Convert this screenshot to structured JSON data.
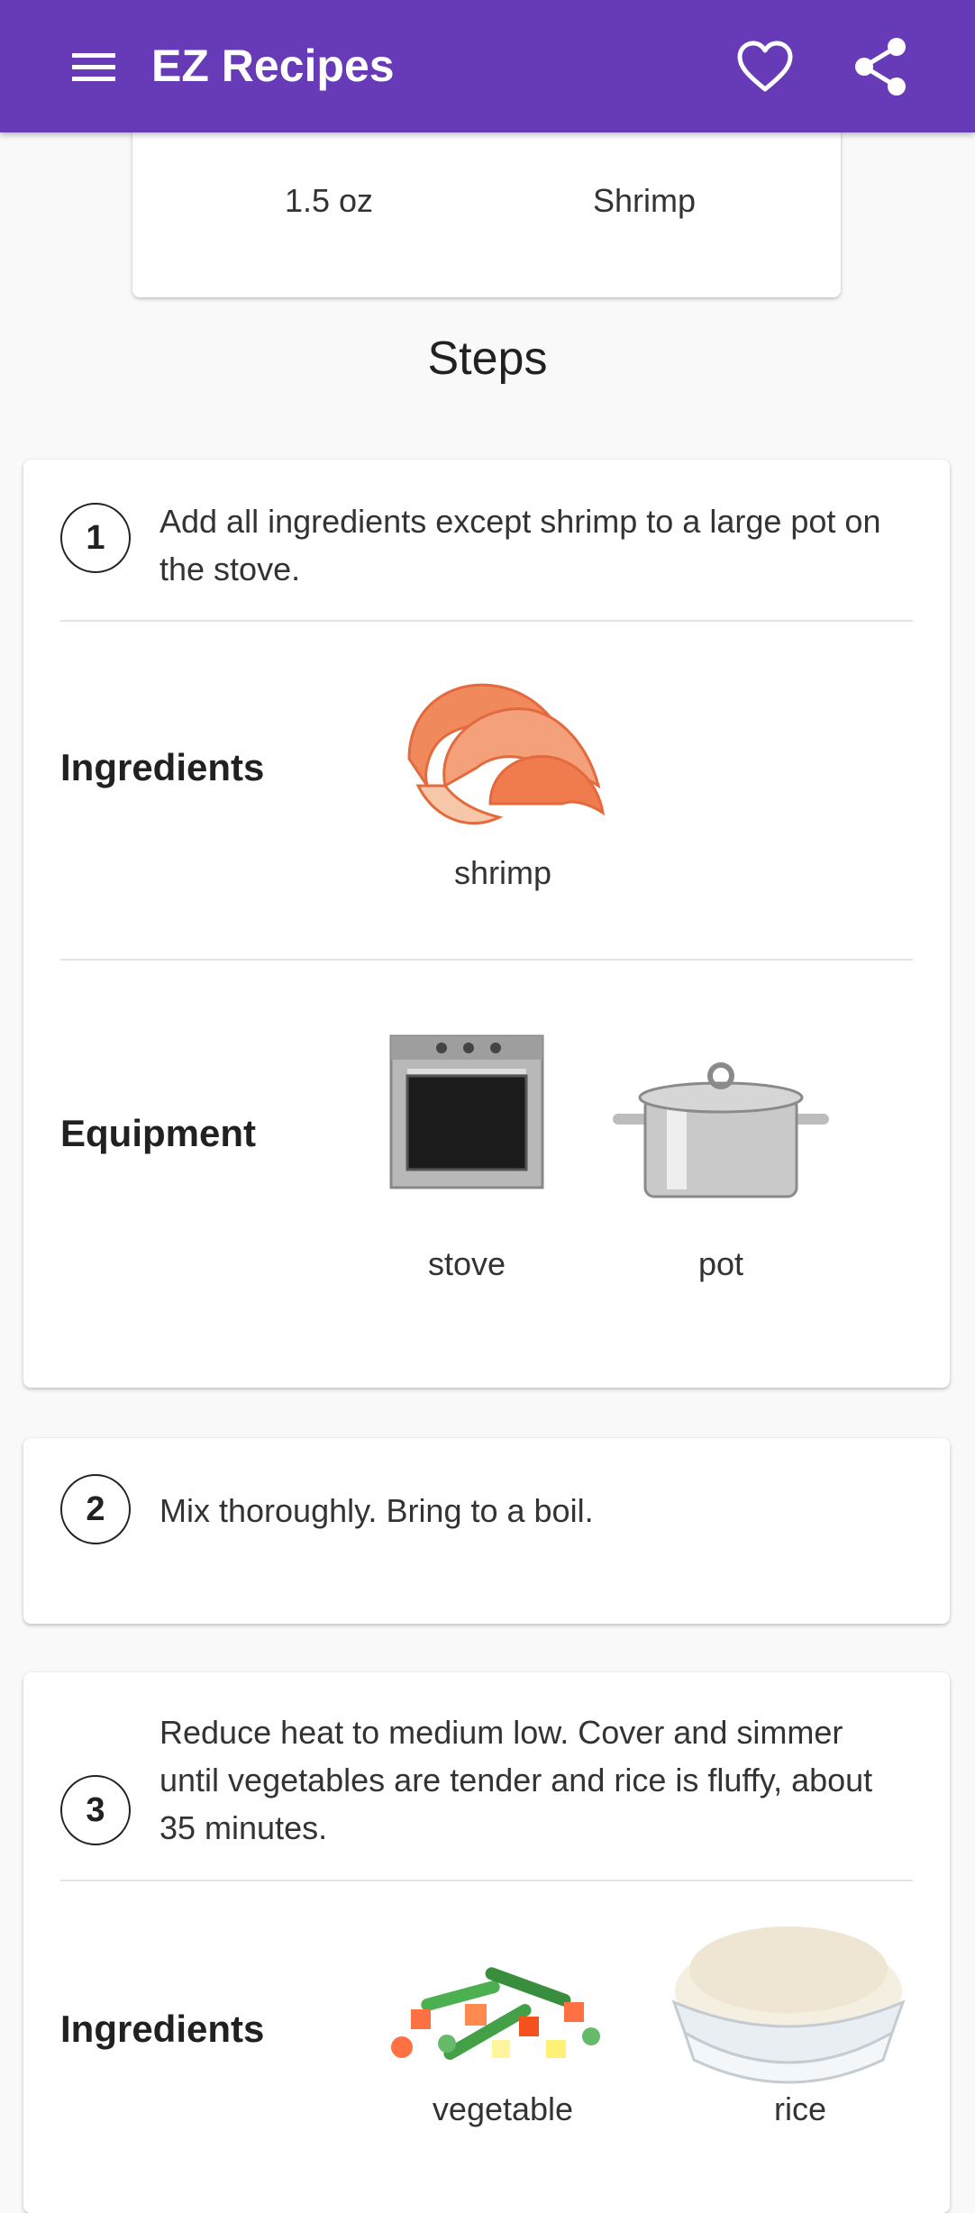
{
  "app_bar": {
    "title": "EZ Recipes",
    "background": "#673ab7",
    "icons": [
      "menu-icon",
      "favorite-icon",
      "share-icon"
    ]
  },
  "ingredients_card": {
    "amount": "1.5 oz",
    "name": "Shrimp"
  },
  "steps_heading": "Steps",
  "steps": [
    {
      "number": "1",
      "text": "Add all ingredients except shrimp to a large pot on the stove.",
      "ingredients_label": "Ingredients",
      "ingredients": [
        {
          "name": "shrimp",
          "icon": "shrimp-image"
        }
      ],
      "equipment_label": "Equipment",
      "equipment": [
        {
          "name": "stove",
          "icon": "stove-image"
        },
        {
          "name": "pot",
          "icon": "pot-image"
        }
      ]
    },
    {
      "number": "2",
      "text": "Mix thoroughly. Bring to a boil."
    },
    {
      "number": "3",
      "text": "Reduce heat to medium low. Cover and simmer until vegetables are tender and rice is fluffy, about 35 minutes.",
      "ingredients_label": "Ingredients",
      "ingredients": [
        {
          "name": "vegetable",
          "icon": "vegetable-image"
        },
        {
          "name": "rice",
          "icon": "rice-image"
        }
      ]
    }
  ]
}
